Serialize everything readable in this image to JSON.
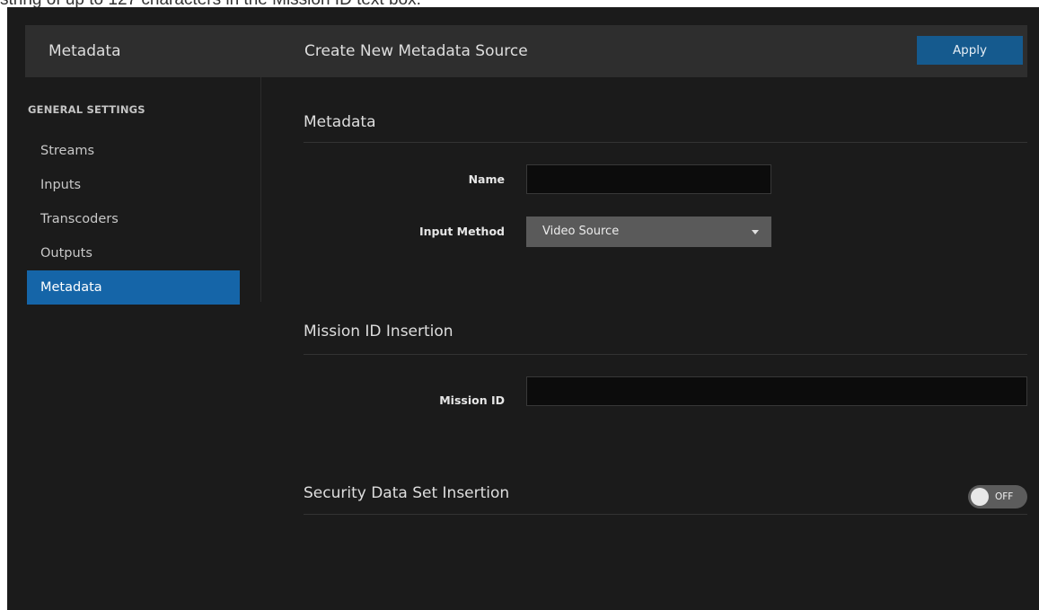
{
  "document": {
    "caption": "string of up to 127 characters in the Mission ID text box."
  },
  "header": {
    "sidebar_title": "Metadata",
    "page_title": "Create New Metadata Source",
    "apply_label": "Apply"
  },
  "sidebar": {
    "heading": "GENERAL SETTINGS",
    "items": [
      {
        "label": "Streams"
      },
      {
        "label": "Inputs"
      },
      {
        "label": "Transcoders"
      },
      {
        "label": "Outputs"
      },
      {
        "label": "Metadata",
        "active": true
      }
    ]
  },
  "metadata_section": {
    "title": "Metadata",
    "name_label": "Name",
    "name_value": "",
    "input_method_label": "Input Method",
    "input_method_value": "Video Source"
  },
  "mission_section": {
    "title": "Mission ID Insertion",
    "mission_id_label": "Mission ID",
    "mission_id_value": ""
  },
  "security_section": {
    "title": "Security Data Set Insertion",
    "toggle_label": "OFF",
    "toggle_on": false
  },
  "colors": {
    "accent": "#1565a8",
    "apply_button": "#155a8e",
    "background": "#1b1b1b",
    "header": "#2e2e2e"
  }
}
